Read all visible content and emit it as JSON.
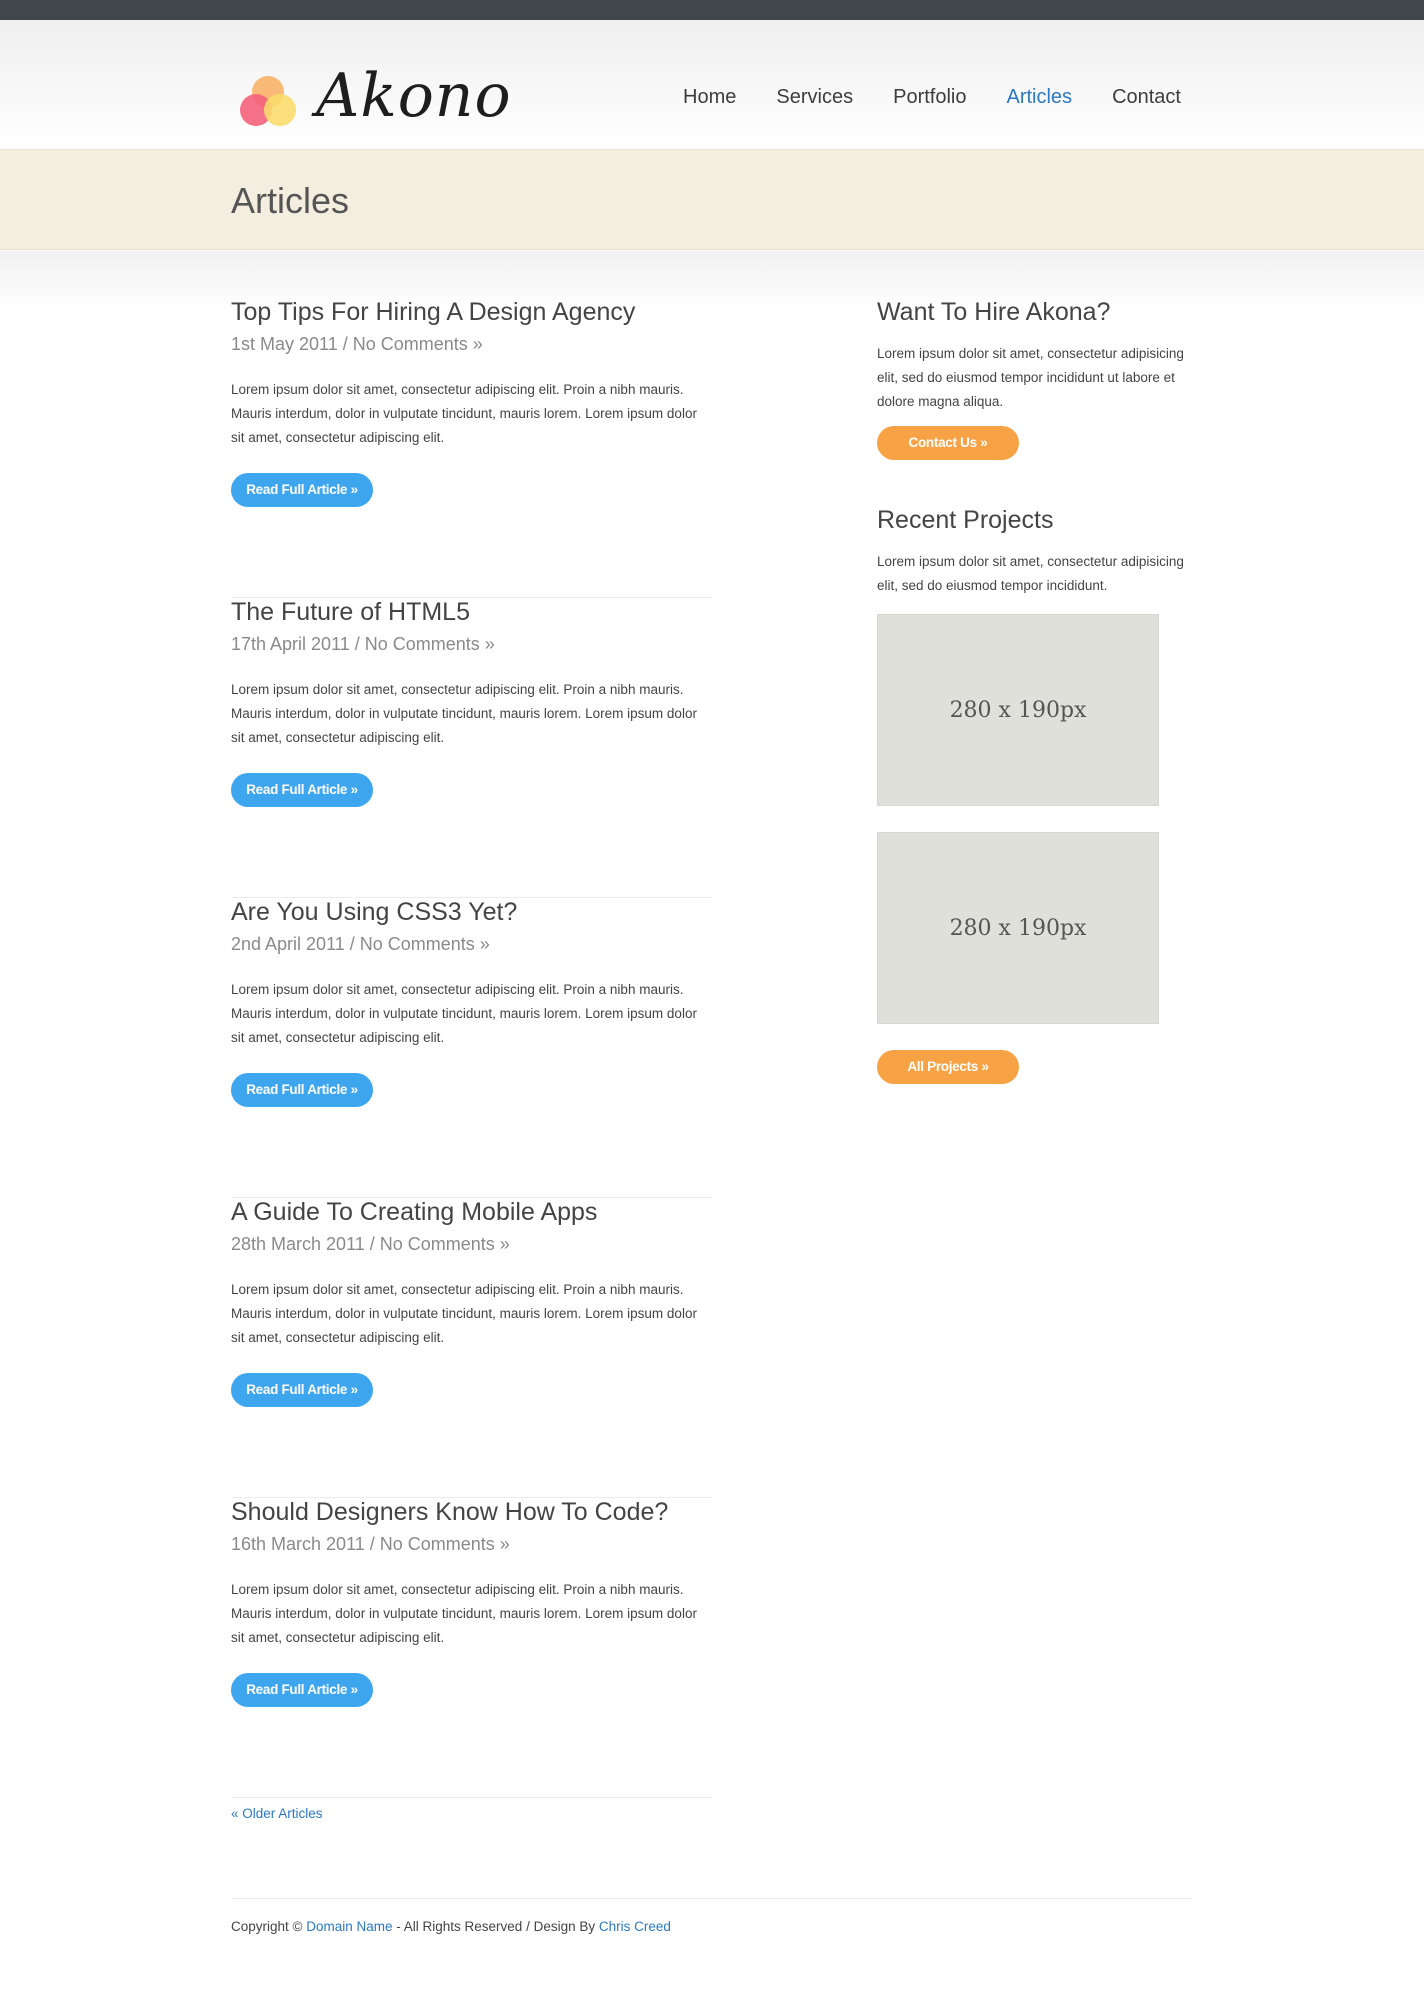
{
  "brand": {
    "name": "Akono"
  },
  "nav": {
    "items": [
      {
        "label": "Home"
      },
      {
        "label": "Services"
      },
      {
        "label": "Portfolio"
      },
      {
        "label": "Articles"
      },
      {
        "label": "Contact"
      }
    ],
    "active": "Articles"
  },
  "page": {
    "title": "Articles"
  },
  "posts": [
    {
      "title": "Top Tips For Hiring A Design Agency",
      "meta": "1st May 2011 / No Comments »",
      "excerpt": "Lorem ipsum dolor sit amet, consectetur adipiscing elit. Proin a nibh mauris. Mauris interdum, dolor in vulputate tincidunt, mauris lorem. Lorem ipsum dolor sit amet, consectetur adipiscing elit.",
      "button": "Read Full Article »"
    },
    {
      "title": "The Future of HTML5",
      "meta": "17th April 2011 / No Comments »",
      "excerpt": "Lorem ipsum dolor sit amet, consectetur adipiscing elit. Proin a nibh mauris. Mauris interdum, dolor in vulputate tincidunt, mauris lorem. Lorem ipsum dolor sit amet, consectetur adipiscing elit.",
      "button": "Read Full Article »"
    },
    {
      "title": "Are You Using CSS3 Yet?",
      "meta": "2nd April 2011 / No Comments »",
      "excerpt": "Lorem ipsum dolor sit amet, consectetur adipiscing elit. Proin a nibh mauris. Mauris interdum, dolor in vulputate tincidunt, mauris lorem. Lorem ipsum dolor sit amet, consectetur adipiscing elit.",
      "button": "Read Full Article »"
    },
    {
      "title": "A Guide To Creating Mobile Apps",
      "meta": "28th March 2011 / No Comments »",
      "excerpt": "Lorem ipsum dolor sit amet, consectetur adipiscing elit. Proin a nibh mauris. Mauris interdum, dolor in vulputate tincidunt, mauris lorem. Lorem ipsum dolor sit amet, consectetur adipiscing elit.",
      "button": "Read Full Article »"
    },
    {
      "title": "Should Designers Know How To Code?",
      "meta": "16th March 2011 / No Comments »",
      "excerpt": "Lorem ipsum dolor sit amet, consectetur adipiscing elit. Proin a nibh mauris. Mauris interdum, dolor in vulputate tincidunt, mauris lorem. Lorem ipsum dolor sit amet, consectetur adipiscing elit.",
      "button": "Read Full Article »"
    }
  ],
  "pagination": {
    "older": "« Older Articles"
  },
  "sidebar": {
    "hire": {
      "title": "Want To Hire Akona?",
      "text": "Lorem ipsum dolor sit amet, consectetur adipisicing elit, sed do eiusmod tempor incididunt ut labore et dolore magna aliqua.",
      "button": "Contact Us »"
    },
    "projects": {
      "title": "Recent Projects",
      "text": "Lorem ipsum dolor sit amet, consectetur adipisicing elit, sed do eiusmod tempor incididunt.",
      "thumbs": [
        {
          "label": "280 x 190px"
        },
        {
          "label": "280 x 190px"
        }
      ],
      "button": "All Projects »"
    }
  },
  "footer": {
    "prefix": "Copyright © ",
    "domain_link": "Domain Name",
    "middle": " - All Rights Reserved / Design By ",
    "designer_link": "Chris Creed"
  },
  "colors": {
    "accent_link": "#2a78c2",
    "button_blue": "#3ea6ee",
    "button_orange": "#f7a244",
    "banner_bg": "#f4eee1",
    "topbar": "#41464d"
  }
}
